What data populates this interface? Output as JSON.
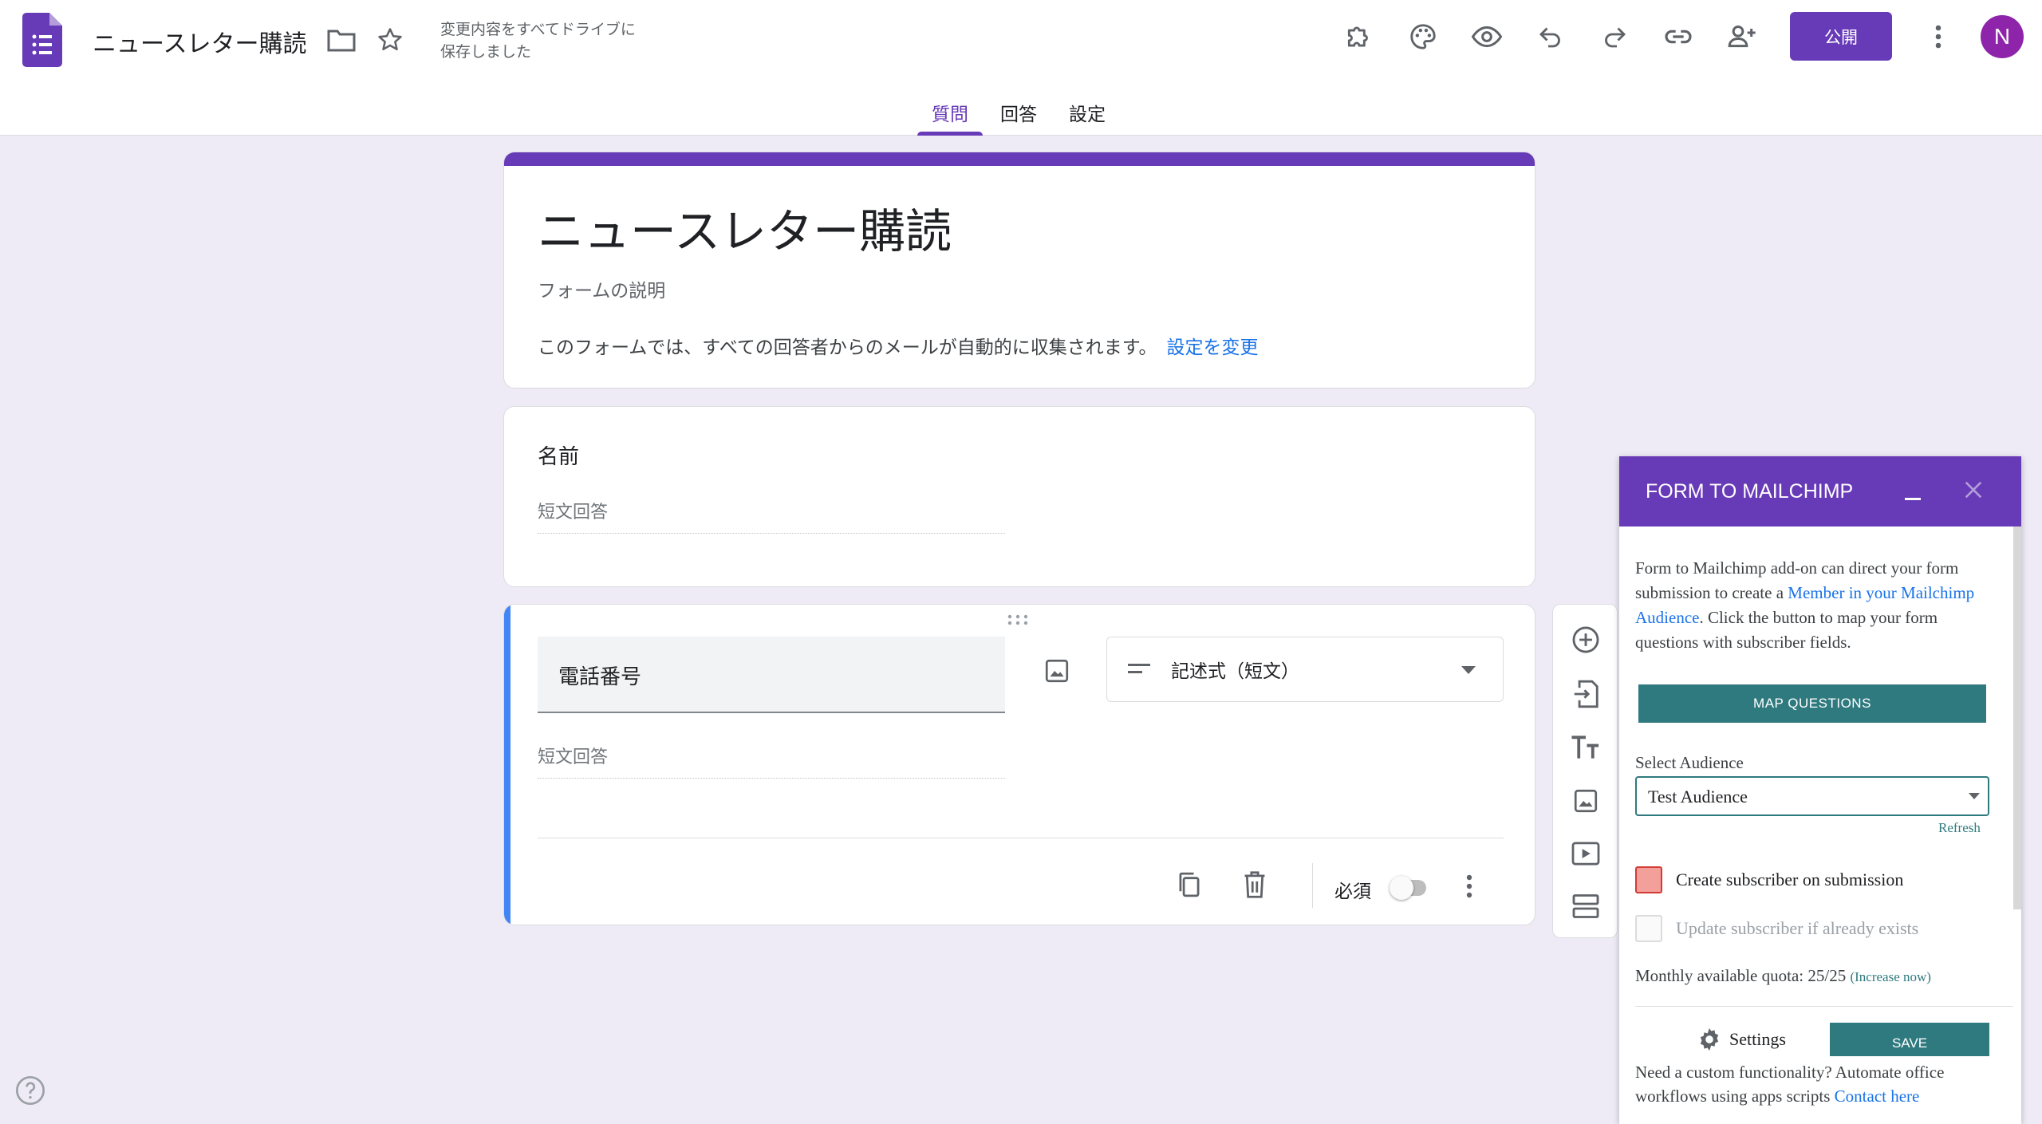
{
  "header": {
    "doc_title": "ニュースレター購読",
    "save_status_line1": "変更内容をすべてドライブに",
    "save_status_line2": "保存しました",
    "publish_label": "公開",
    "avatar_initial": "N"
  },
  "tabs": [
    {
      "label": "質問",
      "active": true
    },
    {
      "label": "回答",
      "active": false
    },
    {
      "label": "設定",
      "active": false
    }
  ],
  "form": {
    "title": "ニュースレター購読",
    "description_placeholder": "フォームの説明",
    "email_note": "このフォームでは、すべての回答者からのメールが自動的に収集されます。",
    "email_note_link": "設定を変更"
  },
  "questions": [
    {
      "title": "名前",
      "answer_placeholder": "短文回答"
    },
    {
      "title": "電話番号",
      "answer_placeholder": "短文回答",
      "type": "記述式（短文）",
      "required_label": "必須",
      "required": false
    }
  ],
  "addon": {
    "title": "FORM TO MAILCHIMP",
    "desc_part1": "Form to Mailchimp add-on can direct your form submission to create a ",
    "desc_link": "Member in your Mailchimp Audience",
    "desc_part2": ". Click the button to map your form questions with subscriber fields.",
    "map_button": "MAP QUESTIONS",
    "select_label": "Select Audience",
    "selected_audience": "Test Audience",
    "refresh": "Refresh",
    "checkbox_create": "Create subscriber on submission",
    "checkbox_update": "Update subscriber if already exists",
    "quota_text": "Monthly available quota: 25/25",
    "quota_link": "(Increase now)",
    "settings_label": "Settings",
    "save_label": "SAVE",
    "bottom_text": "Need a custom functionality? Automate office workflows using apps scripts ",
    "bottom_link": "Contact here"
  },
  "colors": {
    "accent": "#673ab7",
    "teal": "#2f7a7f",
    "link": "#1a73e8",
    "background": "#efebf6"
  }
}
